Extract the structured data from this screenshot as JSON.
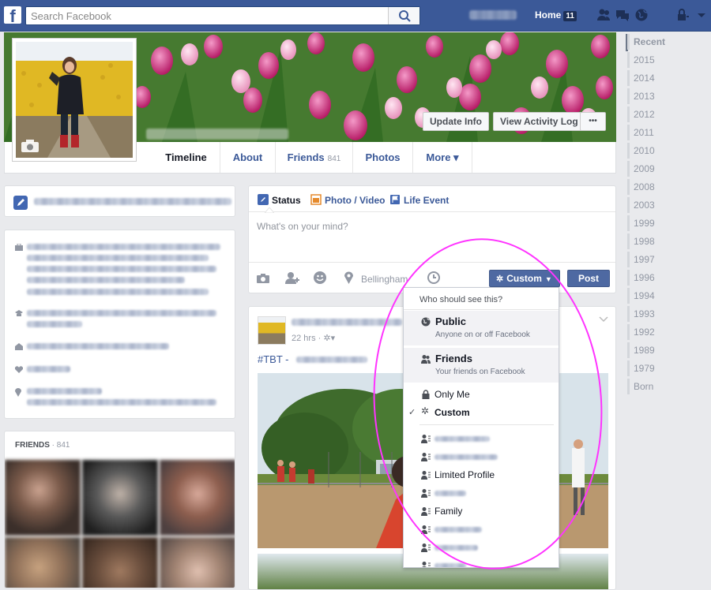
{
  "topbar": {
    "logo_letter": "f",
    "search_placeholder": "Search Facebook",
    "home_label": "Home",
    "home_badge": "11",
    "icons": [
      "search-icon",
      "friend-requests-icon",
      "messages-icon",
      "notifications-globe-icon",
      "privacy-lock-icon",
      "account-menu-chevron-icon"
    ]
  },
  "cover": {
    "buttons": {
      "update_info": "Update Info",
      "activity_log": "View Activity Log",
      "more": "•••"
    }
  },
  "tabs": [
    {
      "label": "Timeline"
    },
    {
      "label": "About"
    },
    {
      "label": "Friends",
      "count": "841"
    },
    {
      "label": "Photos"
    },
    {
      "label": "More ▾"
    }
  ],
  "friends_box": {
    "title": "FRIENDS",
    "sep": " · ",
    "count": "841"
  },
  "composer": {
    "tabs": [
      "Status",
      "Photo / Video",
      "Life Event"
    ],
    "placeholder": "What's on your mind?",
    "location": "Bellingham",
    "audience_label": "Custom",
    "post_label": "Post"
  },
  "feed_post": {
    "time": "22 hrs ·",
    "text_prefix": "#TBT -"
  },
  "audience_menu": {
    "header": "Who should see this?",
    "options": [
      {
        "title": "Public",
        "subtitle": "Anyone on or off Facebook"
      },
      {
        "title": "Friends",
        "subtitle": "Your friends on Facebook"
      }
    ],
    "items": [
      {
        "label": "Only Me"
      },
      {
        "label": "Custom",
        "checked": true
      }
    ],
    "lists": [
      "Limited Profile",
      "Family"
    ]
  },
  "year_nav": [
    "Recent",
    "2015",
    "2014",
    "2013",
    "2012",
    "2011",
    "2010",
    "2009",
    "2008",
    "2003",
    "1999",
    "1998",
    "1997",
    "1996",
    "1994",
    "1993",
    "1992",
    "1989",
    "1979",
    "Born"
  ],
  "colors": {
    "brand": "#3b5998",
    "button": "#4e69a2",
    "annotation": "#ff33ff"
  }
}
